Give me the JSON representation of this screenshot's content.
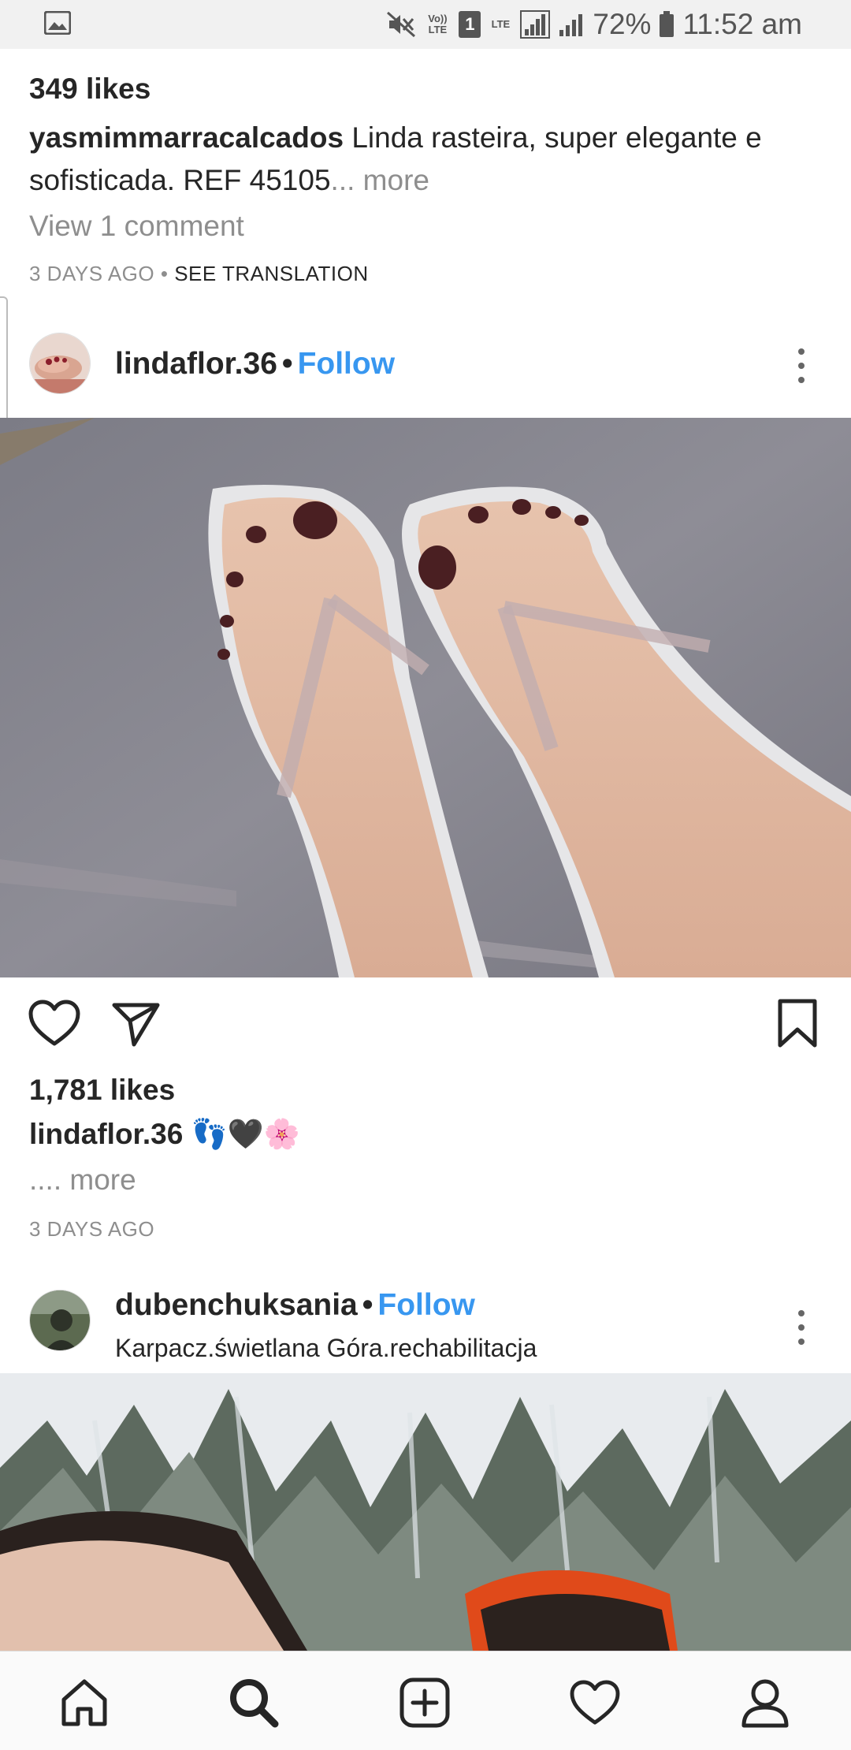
{
  "status_bar": {
    "volte_label": "Vo)) LTE",
    "sim_slot": "1",
    "lte_label": "LTE",
    "battery": "72%",
    "time": "11:52 am"
  },
  "previous_post": {
    "likes": "349 likes",
    "caption_user": "yasmimmarracalcados",
    "caption_text": "Linda rasteira, super elegante e sofisticada. REF 45105",
    "caption_more": "... more",
    "view_comments": "View 1 comment",
    "date": "3 DAYS AGO",
    "separator": "•",
    "see_translation": "SEE TRANSLATION"
  },
  "post1": {
    "username": "lindaflor.36",
    "dot": "•",
    "follow": "Follow",
    "likes": "1,781 likes",
    "caption_user": "lindaflor.36",
    "caption_text": "👣🖤🌸",
    "caption_more": ".... more",
    "date": "3 DAYS AGO"
  },
  "post2": {
    "username": "dubenchuksania",
    "dot": "•",
    "follow": "Follow",
    "location": "Karpacz.świetlana Góra.rechabilitacja"
  },
  "icons": {
    "gallery": "image-icon",
    "mute": "mute-icon",
    "signal": "signal-icon",
    "battery": "battery-icon",
    "like": "heart-icon",
    "share": "send-icon",
    "save": "bookmark-icon",
    "home": "home-icon",
    "search": "search-icon",
    "new_post": "add-post-icon",
    "activity": "heart-icon",
    "profile": "profile-icon"
  },
  "colors": {
    "follow": "#3897f0",
    "muted_text": "#8e8e8e",
    "text": "#262626"
  }
}
